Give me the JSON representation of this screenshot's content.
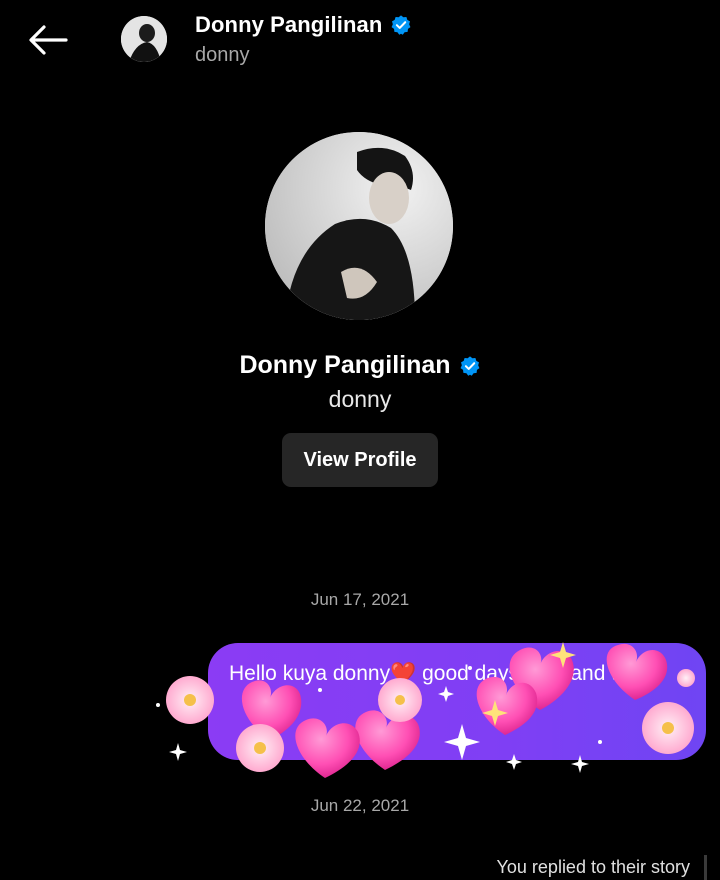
{
  "header": {
    "name": "Donny Pangilinan",
    "handle": "donny",
    "back_icon": "arrow-left-icon",
    "verified_icon": "verified-badge-icon"
  },
  "profile": {
    "name": "Donny Pangilinan",
    "handle": "donny",
    "view_profile_label": "View Profile"
  },
  "messages": {
    "date1": "Jun 17, 2021",
    "bubble_text": "Hello kuya donny❤️ good days safe and to",
    "date2": "Jun 22, 2021",
    "reply_note": "You replied to their story"
  },
  "colors": {
    "background": "#000000",
    "bubble": "#8b3cf4",
    "verified": "#0095f6",
    "button": "#262626"
  }
}
